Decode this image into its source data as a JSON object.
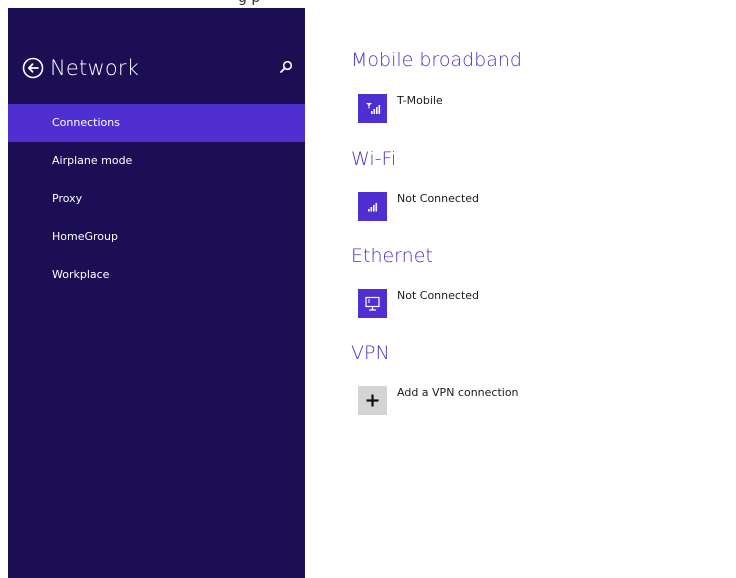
{
  "top_caption": "g  p",
  "sidebar": {
    "title": "Network",
    "back_icon": "back-arrow-circle-icon",
    "search_icon": "search-icon",
    "items": [
      {
        "label": "Connections",
        "active": true
      },
      {
        "label": "Airplane mode",
        "active": false
      },
      {
        "label": "Proxy",
        "active": false
      },
      {
        "label": "HomeGroup",
        "active": false
      },
      {
        "label": "Workplace",
        "active": false
      }
    ]
  },
  "main": {
    "sections": [
      {
        "title": "Mobile broadband",
        "item": {
          "label": "T-Mobile",
          "icon": "mobile-signal-icon"
        }
      },
      {
        "title": "Wi-Fi",
        "item": {
          "label": "Not Connected",
          "icon": "wifi-signal-icon"
        }
      },
      {
        "title": "Ethernet",
        "item": {
          "label": "Not Connected",
          "icon": "ethernet-icon"
        }
      },
      {
        "title": "VPN",
        "item": {
          "label": "Add a VPN connection",
          "icon": "plus-icon"
        }
      }
    ]
  },
  "colors": {
    "sidebar_bg": "#1c0e55",
    "active_item": "#4f2fd1",
    "accent": "#4e31c7",
    "tile_gray": "#d4d4d4"
  }
}
